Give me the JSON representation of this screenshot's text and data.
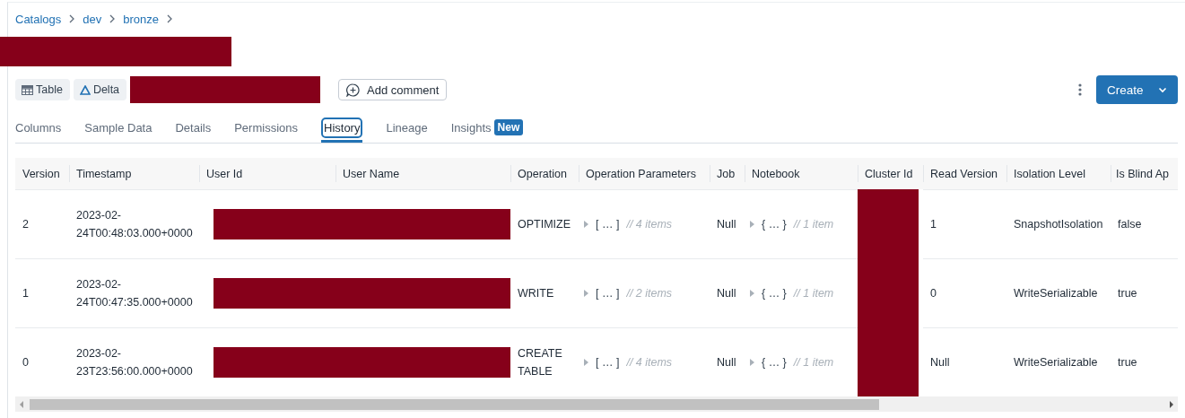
{
  "breadcrumb": [
    {
      "label": "Catalogs"
    },
    {
      "label": "dev"
    },
    {
      "label": "bronze"
    }
  ],
  "title": {
    "redacted": true
  },
  "tags": [
    {
      "kind": "table",
      "label": "Table"
    },
    {
      "kind": "delta",
      "label": "Delta"
    },
    {
      "kind": "redacted"
    }
  ],
  "add_comment_button": {
    "label": "Add comment"
  },
  "create_button": {
    "label": "Create"
  },
  "tabs": [
    {
      "label": "Columns",
      "selected": false
    },
    {
      "label": "Sample Data",
      "selected": false
    },
    {
      "label": "Details",
      "selected": false
    },
    {
      "label": "Permissions",
      "selected": false
    },
    {
      "label": "History",
      "selected": true
    },
    {
      "label": "Lineage",
      "selected": false
    },
    {
      "label": "Insights",
      "selected": false,
      "badge": "New"
    }
  ],
  "table": {
    "columns": [
      "Version",
      "Timestamp",
      "User Id",
      "User Name",
      "Operation",
      "Operation Parameters",
      "Job",
      "Notebook",
      "Cluster Id",
      "Read Version",
      "Isolation Level",
      "Is Blind Ap"
    ],
    "rows": [
      {
        "version": "2",
        "timestamp": "2023-02-\n24T00:48:03.000+0000",
        "user_redacted": true,
        "operation": "OPTIMIZE",
        "operation_parameters": {
          "preview": "[ … ]",
          "count": "// 4 items"
        },
        "job": "Null",
        "notebook": {
          "preview": "{ … }",
          "count": "// 1 item"
        },
        "cluster_id_redacted": true,
        "read_version": "1",
        "isolation_level": "SnapshotIsolation",
        "is_blind_append": "false"
      },
      {
        "version": "1",
        "timestamp": "2023-02-\n24T00:47:35.000+0000",
        "user_redacted": true,
        "operation": "WRITE",
        "operation_parameters": {
          "preview": "[ … ]",
          "count": "// 2 items"
        },
        "job": "Null",
        "notebook": {
          "preview": "{ … }",
          "count": "// 1 item"
        },
        "cluster_id_redacted": true,
        "read_version": "0",
        "isolation_level": "WriteSerializable",
        "is_blind_append": "true"
      },
      {
        "version": "0",
        "timestamp": "2023-02-\n23T23:56:00.000+0000",
        "user_redacted": true,
        "operation": "CREATE TABLE",
        "operation_parameters": {
          "preview": "[ … ]",
          "count": "// 4 items"
        },
        "job": "Null",
        "notebook": {
          "preview": "{ … }",
          "count": "// 1 item"
        },
        "cluster_id_redacted": true,
        "read_version": "Null",
        "isolation_level": "WriteSerializable",
        "is_blind_append": "true"
      }
    ]
  }
}
